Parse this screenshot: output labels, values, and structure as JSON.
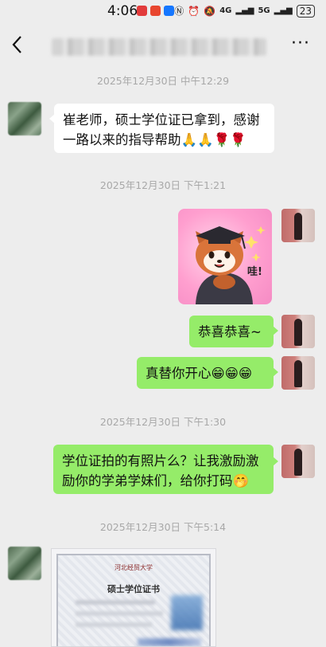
{
  "status_bar": {
    "time": "4:06",
    "network": "4G",
    "network2": "5G",
    "battery": "23"
  },
  "header": {
    "back_icon": "chevron-left-icon",
    "more_label": "···"
  },
  "timestamps": [
    "2025年12月30日 中午12:29",
    "2025年12月30日 下午1:21",
    "2025年12月30日 下午1:30",
    "2025年12月30日 下午5:14"
  ],
  "messages": {
    "m1_line1": "崔老师，硕士学位证已拿到，感谢",
    "m1_line2": "一路以来的指导帮助🙏🙏🌹🌹",
    "m3": "恭喜恭喜~",
    "m4": "真替你开心😁😁😁",
    "m5_line1": "学位证拍的有照片么？让我激励激",
    "m5_line2": "励你的学弟学妹们，给你打码🤭"
  },
  "sticker": {
    "text": "哇!"
  },
  "certificate": {
    "university": "河北经贸大学",
    "title": "硕士学位证书"
  },
  "colors": {
    "background": "#ededed",
    "sent_bubble": "#95ec69",
    "received_bubble": "#ffffff",
    "timestamp": "#a8a8a8"
  }
}
